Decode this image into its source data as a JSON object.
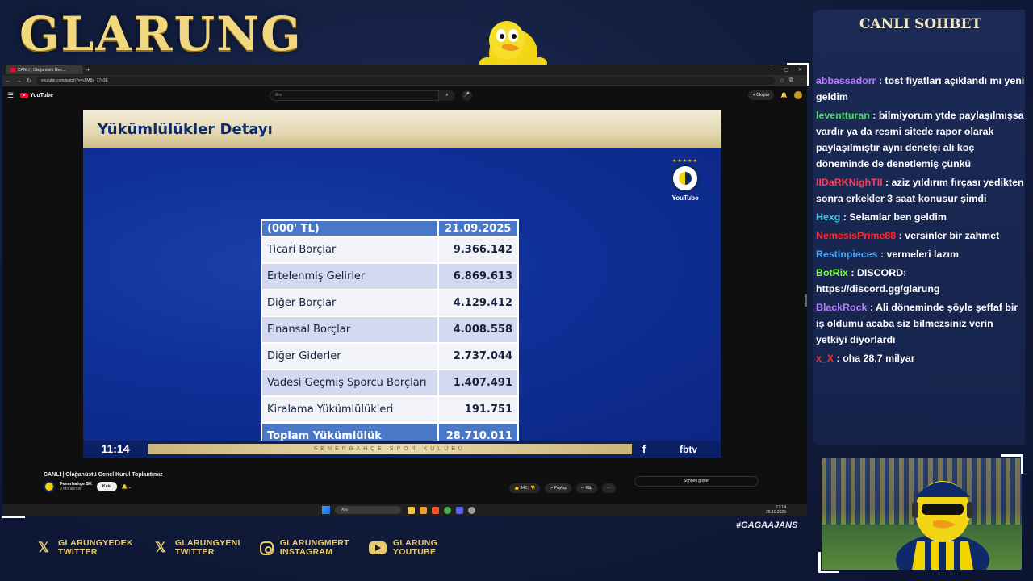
{
  "overlay": {
    "brand": "GLARUNG",
    "hashtag": "#GAGAAJANS",
    "socials": [
      {
        "icon": "x-icon",
        "line1": "GLARUNGYEDEK",
        "line2": "TWITTER"
      },
      {
        "icon": "x-icon",
        "line1": "GLARUNGYENI",
        "line2": "TWITTER"
      },
      {
        "icon": "instagram-icon",
        "line1": "GLARUNGMERT",
        "line2": "INSTAGRAM"
      },
      {
        "icon": "youtube-icon",
        "line1": "GLARUNG",
        "line2": "YOUTUBE"
      }
    ]
  },
  "browser": {
    "tab_title": "CANLI | Olağanüstü Gen...",
    "url": "youtube.com/watch?v=s5M8s_17s3E"
  },
  "youtube": {
    "search_placeholder": "Ara",
    "create_label": "Oluştur",
    "video_title": "CANLI | Olağanüstü Genel Kurul Toplantımız",
    "channel_name": "Fenerbahçe SK",
    "channel_subs": "3 Mn abone",
    "join_label": "Katıl",
    "like_count": "846",
    "share_label": "Paylaş",
    "clip_label": "Klip",
    "show_chat_label": "Sohbeti göster"
  },
  "slide": {
    "title": "Yükümlülükler Detayı",
    "badge_label": "YouTube",
    "table": {
      "header_label": "(000' TL)",
      "header_date": "21.09.2025",
      "rows": [
        {
          "label": "Ticari Borçlar",
          "value": "9.366.142"
        },
        {
          "label": "Ertelenmiş Gelirler",
          "value": "6.869.613"
        },
        {
          "label": "Diğer Borçlar",
          "value": "4.129.412"
        },
        {
          "label": "Finansal Borçlar",
          "value": "4.008.558"
        },
        {
          "label": "Diğer Giderler",
          "value": "2.737.044"
        },
        {
          "label": "Vadesi Geçmiş Sporcu Borçları",
          "value": "1.407.491"
        },
        {
          "label": "Kiralama Yükümlülükleri",
          "value": "191.751"
        }
      ],
      "total_label": "Toplam Yükümlülük",
      "total_value": "28.710.011"
    },
    "ticker_time": "11:14",
    "ticker_text": "FENERBAHÇE SPOR KULÜBÜ",
    "ticker_channel": "fbtv"
  },
  "taskbar": {
    "search_placeholder": "Ara",
    "time": "12:14",
    "date": "25.10.2025"
  },
  "chat": {
    "title": "CANLI SOHBET",
    "messages": [
      {
        "user": "abbassadorr",
        "color": "#b57bff",
        "text": "tost fiyatları açıklandı mı yeni geldim"
      },
      {
        "user": "leventturan",
        "color": "#4cd964",
        "text": "bilmiyorum ytde paylaşılmışsa vardır ya da resmi sitede rapor olarak paylaşılmıştır aynı denetçi ali koç döneminde de denetlemiş çünkü"
      },
      {
        "user": "IIDaRKNighTII",
        "color": "#ff3b57",
        "text": "aziz yıldırım fırçası yedikten sonra erkekler 3 saat konusur şimdi"
      },
      {
        "user": "Hexg",
        "color": "#39c9e6",
        "text": "Selamlar ben geldim"
      },
      {
        "user": "NemesisPrime88",
        "color": "#ff2a2a",
        "text": "versinler bir zahmet"
      },
      {
        "user": "RestInpieces",
        "color": "#3ea8ff",
        "text": "vermeleri lazım"
      },
      {
        "user": "BotRix",
        "color": "#7cff3a",
        "text": "DISCORD: https://discord.gg/glarung"
      },
      {
        "user": "BlackRock",
        "color": "#b57bff",
        "text": "Ali döneminde şöyle şeffaf bir iş oldumu acaba siz bilmezsiniz verin yetkiyi diyorlardı"
      },
      {
        "user": "x_X",
        "color": "#ff2a2a",
        "text": "oha 28,7 milyar"
      }
    ]
  },
  "colors": {
    "gold": "#e8c96c",
    "slide_blue": "#10319a",
    "table_header": "#4a78c9"
  }
}
